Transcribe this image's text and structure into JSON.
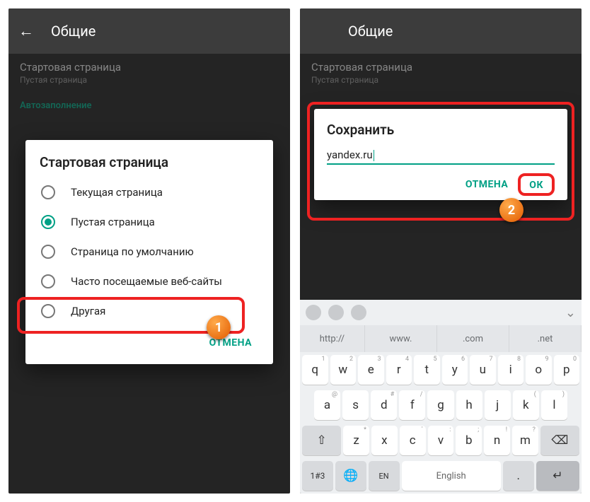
{
  "left": {
    "toolbar_title": "Общие",
    "setting_title": "Стартовая страница",
    "setting_sub": "Пустая страница",
    "section_autofill": "Автозаполнение",
    "dialog_title": "Стартовая страница",
    "options": [
      "Текущая страница",
      "Пустая страница",
      "Страница по умолчанию",
      "Часто посещаемые веб-сайты",
      "Другая"
    ],
    "selected_index": 1,
    "cancel": "ОТМЕНА",
    "callout": "1"
  },
  "right": {
    "toolbar_title": "Общие",
    "setting_title": "Стартовая страница",
    "setting_sub": "Пустая страница",
    "dialog_title": "Сохранить",
    "input_value": "yandex.ru",
    "cancel": "ОТМЕНА",
    "ok": "ОК",
    "callout": "2",
    "suggestions": [
      "http://",
      "www.",
      ".com",
      ".net"
    ],
    "rows": {
      "r1": [
        {
          "k": "q",
          "s": "1"
        },
        {
          "k": "w",
          "s": "2"
        },
        {
          "k": "e",
          "s": "3"
        },
        {
          "k": "r",
          "s": "4"
        },
        {
          "k": "t",
          "s": "5"
        },
        {
          "k": "y",
          "s": "6"
        },
        {
          "k": "u",
          "s": "7"
        },
        {
          "k": "i",
          "s": "8"
        },
        {
          "k": "o",
          "s": "9"
        },
        {
          "k": "p",
          "s": "0"
        }
      ],
      "r2": [
        {
          "k": "a",
          "s": "@"
        },
        {
          "k": "s",
          "s": ""
        },
        {
          "k": "d",
          "s": "#"
        },
        {
          "k": "f",
          "s": "/"
        },
        {
          "k": "g",
          "s": ""
        },
        {
          "k": "h",
          "s": ""
        },
        {
          "k": "j",
          "s": ""
        },
        {
          "k": "k",
          "s": "("
        },
        {
          "k": "l",
          "s": ")"
        }
      ],
      "r3": [
        {
          "k": "z",
          "s": "*"
        },
        {
          "k": "x",
          "s": ""
        },
        {
          "k": "c",
          "s": "'"
        },
        {
          "k": "v",
          "s": ":"
        },
        {
          "k": "b",
          "s": ";"
        },
        {
          "k": "n",
          "s": "!"
        },
        {
          "k": "m",
          "s": "?"
        }
      ],
      "shift": "⇧",
      "back": "⌫",
      "num": "1#3",
      "globe": "🌐",
      "lang": "EN",
      "space": "English",
      "dot": ".",
      "enter": "↵"
    }
  }
}
